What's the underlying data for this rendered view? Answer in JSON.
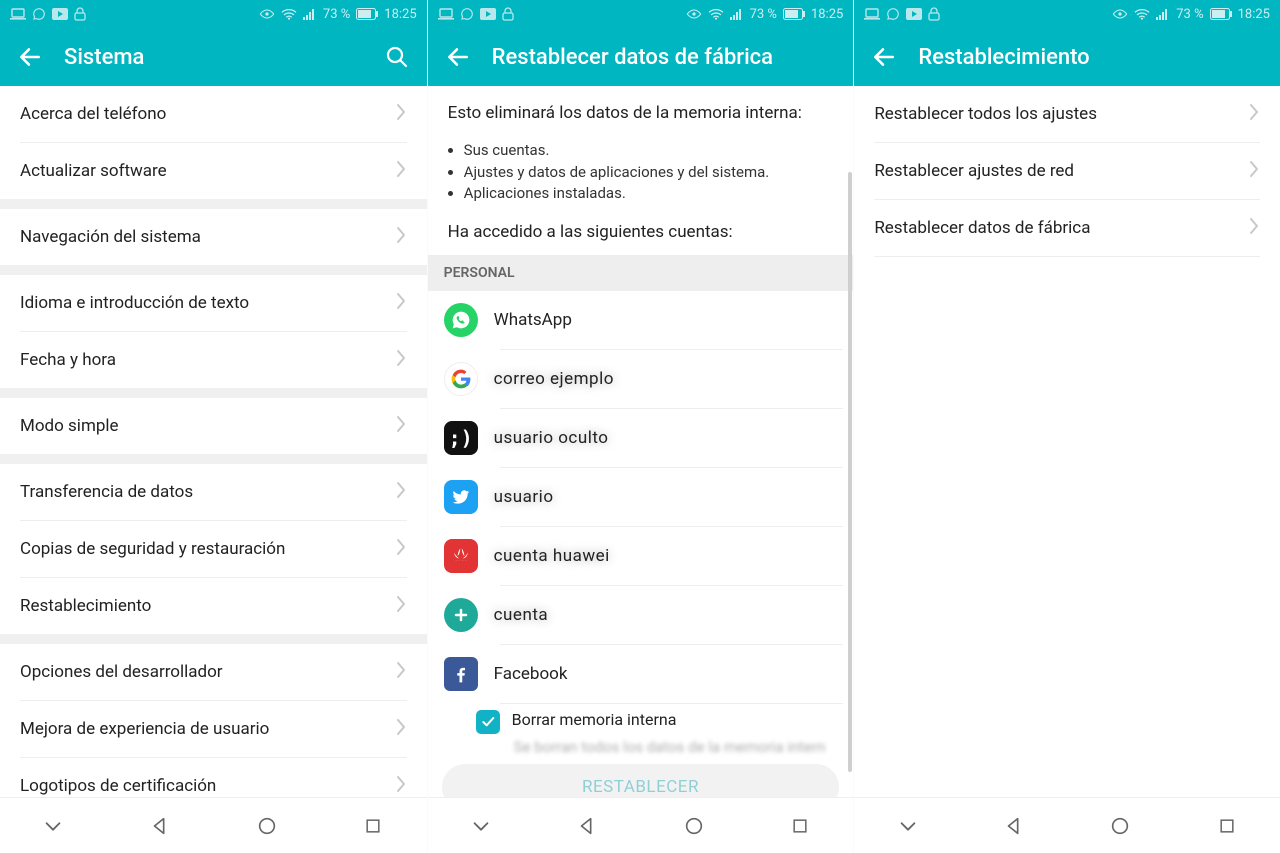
{
  "status": {
    "battery_pct": "73 %",
    "time": "18:25"
  },
  "pane1": {
    "title": "Sistema",
    "groups": [
      {
        "items": [
          {
            "label": "Acerca del teléfono",
            "name": "about-phone-row"
          },
          {
            "label": "Actualizar software",
            "name": "software-update-row"
          }
        ]
      },
      {
        "items": [
          {
            "label": "Navegación del sistema",
            "name": "system-navigation-row"
          }
        ]
      },
      {
        "items": [
          {
            "label": "Idioma e introducción de texto",
            "name": "language-input-row"
          },
          {
            "label": "Fecha y hora",
            "name": "date-time-row"
          }
        ]
      },
      {
        "items": [
          {
            "label": "Modo simple",
            "name": "simple-mode-row"
          }
        ]
      },
      {
        "items": [
          {
            "label": "Transferencia de datos",
            "name": "data-transfer-row"
          },
          {
            "label": "Copias de seguridad y restauración",
            "name": "backup-restore-row"
          },
          {
            "label": "Restablecimiento",
            "name": "reset-row"
          }
        ]
      },
      {
        "items": [
          {
            "label": "Opciones del desarrollador",
            "name": "developer-options-row"
          },
          {
            "label": "Mejora de experiencia de usuario",
            "name": "user-experience-row"
          },
          {
            "label": "Logotipos de certificación",
            "name": "certification-logos-row"
          }
        ]
      }
    ]
  },
  "pane2": {
    "title": "Restablecer datos de fábrica",
    "intro": "Esto eliminará los datos de la memoria interna:",
    "bullets": [
      "Sus cuentas.",
      "Ajustes y datos de aplicaciones y del sistema.",
      "Aplicaciones instaladas."
    ],
    "signed_in": "Ha accedido a las siguientes cuentas:",
    "section_label": "PERSONAL",
    "accounts": [
      {
        "name": "account-whatsapp",
        "icon": "whatsapp",
        "label": "WhatsApp",
        "blurred": false
      },
      {
        "name": "account-google",
        "icon": "google",
        "label": "correo ejemplo",
        "blurred": true
      },
      {
        "name": "account-generic",
        "icon": "dark",
        "label": "usuario oculto",
        "blurred": true
      },
      {
        "name": "account-twitter",
        "icon": "twitter",
        "label": "usuario",
        "blurred": true
      },
      {
        "name": "account-huawei",
        "icon": "huawei",
        "label": "cuenta huawei",
        "blurred": true
      },
      {
        "name": "account-plus",
        "icon": "plus",
        "label": "cuenta",
        "blurred": true
      },
      {
        "name": "account-facebook",
        "icon": "facebook",
        "label": "Facebook",
        "blurred": false
      }
    ],
    "erase_label": "Borrar memoria interna",
    "cutoff_hint": "Se borran todos los datos de la memoria intern",
    "reset_button": "RESTABLECER"
  },
  "pane3": {
    "title": "Restablecimiento",
    "items": [
      {
        "label": "Restablecer todos los ajustes",
        "name": "reset-all-settings-row"
      },
      {
        "label": "Restablecer ajustes de red",
        "name": "reset-network-settings-row"
      },
      {
        "label": "Restablecer datos de fábrica",
        "name": "factory-reset-row"
      }
    ]
  }
}
